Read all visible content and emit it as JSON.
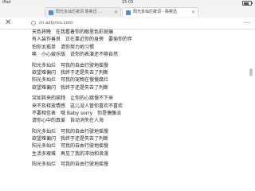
{
  "statusbar": {
    "carrier": "iPad",
    "time": "15:03",
    "battery_level": 0.7
  },
  "tabs": [
    {
      "label": "阳光多灿烂歌词 陈奕迅 …",
      "close": "✕"
    },
    {
      "label": "阳光多灿烂歌词 - 陈奕迅",
      "close": "✕"
    }
  ],
  "address": {
    "close": "✕",
    "url": "cn.azlyrics.com",
    "more": "···"
  },
  "lyrics": [
    "天色将晚　在我看着你的眼里色彩斑斓",
    "有人装作善良　正在靠近你的身旁　要偷你的伴",
    "怕你太孤单　请你努力地习惯",
    "唤　小心娱乐版　说你的表演还不够自然",
    "",
    "阳光多灿烂　可我的自由行驶地摇慢",
    "欲望难偏闪　我终于还是失去了判断",
    "阳光多灿烂　可我的宠物在慢慢腐烂",
    "欲望难偏闪　我终于还是失去了判断",
    "",
    "突如其来的崩拜　让你的心跳慢不下来",
    "来不及释放情感　这儿没人管你喜欢不喜欢",
    "不要相信表　哦 Baby sorry　你是偶像派",
    "请你心中的真爱　自动消失在人海",
    "",
    "阳光多灿烂　可我的自由行驶地摇慢",
    "欲望难偏闪　我终于还是失去了判断",
    "阳光多灿烂　可我的自由行驶地摇慢",
    "生活多艰难　再见了我的冲动和浪漫",
    "",
    "阳光多灿烂　可我的自由行驶地摇慢"
  ]
}
